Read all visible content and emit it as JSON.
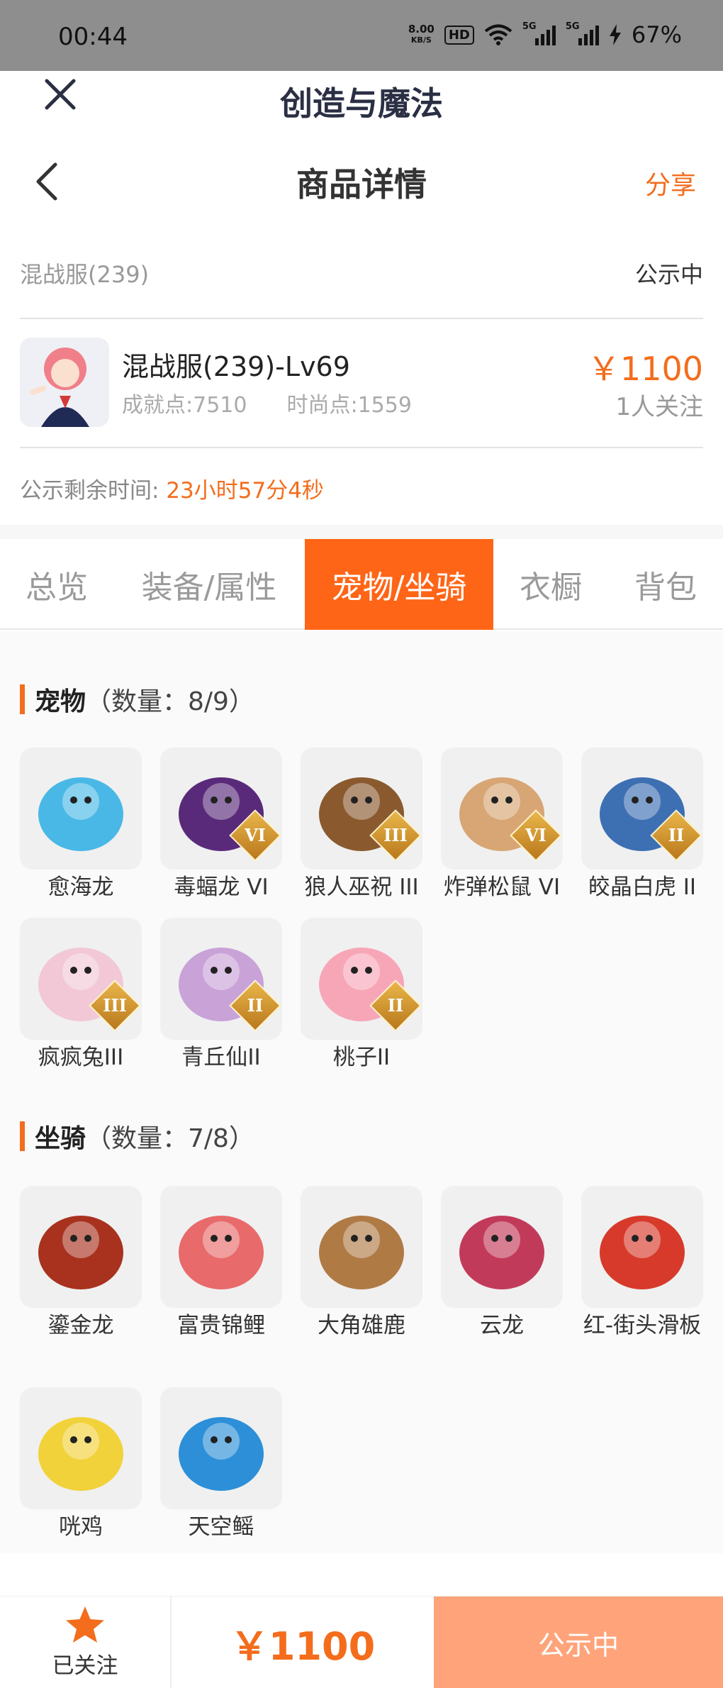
{
  "status_bar": {
    "time": "00:44",
    "net_speed_value": "8.00",
    "net_speed_unit": "KB/S",
    "hd_label": "HD",
    "signal_1": "5G",
    "signal_2": "5G",
    "battery": "67%"
  },
  "app_header": {
    "app_title": "创造与魔法",
    "page_title": "商品详情",
    "share_label": "分享"
  },
  "product": {
    "server": "混战服(239)",
    "status": "公示中",
    "name": "混战服(239)-Lv69",
    "achievement": "成就点:7510",
    "fashion": "时尚点:1559",
    "price": "￥1100",
    "followers": "1人关注",
    "remaining_label": "公示剩余时间:",
    "remaining_value": "23小时57分4秒"
  },
  "tabs": [
    {
      "label": "总览",
      "active": false
    },
    {
      "label": "装备/属性",
      "active": false
    },
    {
      "label": "宠物/坐骑",
      "active": true
    },
    {
      "label": "衣橱",
      "active": false
    },
    {
      "label": "背包",
      "active": false
    }
  ],
  "pets": {
    "title": "宠物",
    "count": "（数量：8/9）",
    "items": [
      {
        "name": "愈海龙",
        "badge": "",
        "icon": "ice-dragon-icon",
        "color": "#49b8e6"
      },
      {
        "name": "毒蝠龙 VI",
        "badge": "VI",
        "icon": "bat-dragon-icon",
        "color": "#5a2a7a"
      },
      {
        "name": "狼人巫祝 III",
        "badge": "III",
        "icon": "werewolf-shaman-icon",
        "color": "#8a5a2e"
      },
      {
        "name": "炸弹松鼠 VI",
        "badge": "VI",
        "icon": "bomb-squirrel-icon",
        "color": "#d8a574"
      },
      {
        "name": "皎晶白虎 II",
        "badge": "II",
        "icon": "white-tiger-icon",
        "color": "#3d6fb3"
      },
      {
        "name": "疯疯兔III",
        "badge": "III",
        "icon": "crazy-rabbit-icon",
        "color": "#f2c8d6"
      },
      {
        "name": "青丘仙II",
        "badge": "II",
        "icon": "fox-fairy-icon",
        "color": "#c9a2d8"
      },
      {
        "name": "桃子II",
        "badge": "II",
        "icon": "peach-pet-icon",
        "color": "#f7a6b8"
      }
    ]
  },
  "mounts": {
    "title": "坐骑",
    "count": "（数量：7/8）",
    "items": [
      {
        "name": "鎏金龙",
        "icon": "golden-dragon-icon",
        "color": "#a8321e"
      },
      {
        "name": "富贵锦鲤",
        "icon": "koi-fish-icon",
        "color": "#e86a6a"
      },
      {
        "name": "大角雄鹿",
        "icon": "stag-icon",
        "color": "#b07a45"
      },
      {
        "name": "云龙",
        "icon": "cloud-dragon-icon",
        "color": "#c23a5a"
      },
      {
        "name": "红-街头滑板",
        "icon": "skateboard-icon",
        "color": "#d73a2a"
      },
      {
        "name": "咣鸡",
        "icon": "chicken-icon",
        "color": "#f2d23a"
      },
      {
        "name": "天空鳐",
        "icon": "sky-ray-icon",
        "color": "#2c8fd8"
      }
    ]
  },
  "bottom_bar": {
    "follow_label": "已关注",
    "price": "￥1100",
    "status": "公示中"
  },
  "colors": {
    "accent": "#f36d1c",
    "tab_active": "#ff6517",
    "status_button": "#ffa47a"
  }
}
